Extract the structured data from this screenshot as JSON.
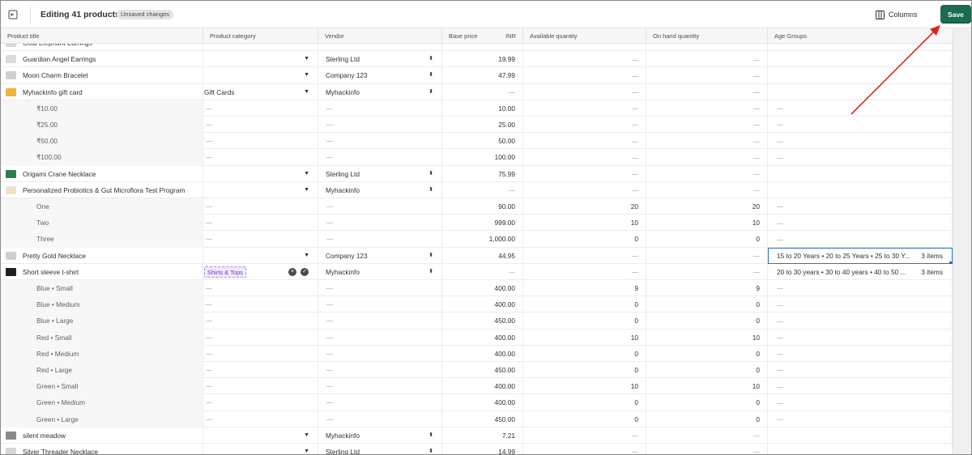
{
  "topbar": {
    "title": "Editing 41 products",
    "badge": "Unsaved changes",
    "columns_label": "Columns",
    "save_label": "Save"
  },
  "columns": {
    "title": "Product title",
    "category": "Product category",
    "vendor": "Vendor",
    "price": "Base price",
    "currency": "INR",
    "available": "Available quantity",
    "onhand": "On hand quantity",
    "age": "Age Groups"
  },
  "rows": [
    {
      "kind": "product",
      "title": "Gold Elephant Earrings",
      "thumb": "#d9d9d9",
      "category": "",
      "vendor": "",
      "price": "",
      "available": "",
      "onhand": "",
      "age": ""
    },
    {
      "kind": "product",
      "title": "Guardian Angel Earrings",
      "thumb": "#dcdcdc",
      "category": "",
      "vendor": "Sterling Ltd",
      "price": "19.99",
      "available": "dash",
      "onhand": "dash",
      "age": ""
    },
    {
      "kind": "product",
      "title": "Moon Charm Bracelet",
      "thumb": "#cfcfcf",
      "category": "",
      "vendor": "Company 123",
      "price": "47.99",
      "available": "dash",
      "onhand": "dash",
      "age": ""
    },
    {
      "kind": "product",
      "title": "Myhackinfo gift card",
      "thumb": "#f1b43a",
      "category": "Gift Cards",
      "vendor": "Myhackinfo",
      "price": "dash",
      "available": "dash",
      "onhand": "dash",
      "age": ""
    },
    {
      "kind": "variant",
      "title": "₹10.00",
      "category": "dash",
      "vendor": "dash",
      "price": "10.00",
      "available": "dash",
      "onhand": "dash",
      "age": "dash"
    },
    {
      "kind": "variant",
      "title": "₹25.00",
      "category": "dash",
      "vendor": "dash",
      "price": "25.00",
      "available": "dash",
      "onhand": "dash",
      "age": "dash"
    },
    {
      "kind": "variant",
      "title": "₹50.00",
      "category": "dash",
      "vendor": "dash",
      "price": "50.00",
      "available": "dash",
      "onhand": "dash",
      "age": "dash"
    },
    {
      "kind": "variant",
      "title": "₹100.00",
      "category": "dash",
      "vendor": "dash",
      "price": "100.00",
      "available": "dash",
      "onhand": "dash",
      "age": "dash"
    },
    {
      "kind": "product",
      "title": "Origami Crane Necklace",
      "thumb": "#2e7d4a",
      "category": "",
      "vendor": "Sterling Ltd",
      "price": "75.99",
      "available": "dash",
      "onhand": "dash",
      "age": ""
    },
    {
      "kind": "product",
      "title": "Personalized Probiotics & Gut Microflora Test Program",
      "thumb": "#efe3c8",
      "category": "",
      "vendor": "Myhackinfo",
      "price": "dash",
      "available": "dash",
      "onhand": "dash",
      "age": ""
    },
    {
      "kind": "variant",
      "title": "One",
      "category": "dash",
      "vendor": "dash",
      "price": "90.00",
      "available": "20",
      "onhand": "20",
      "age": "dash"
    },
    {
      "kind": "variant",
      "title": "Two",
      "category": "dash",
      "vendor": "dash",
      "price": "999.00",
      "available": "10",
      "onhand": "10",
      "age": "dash"
    },
    {
      "kind": "variant",
      "title": "Three",
      "category": "dash",
      "vendor": "dash",
      "price": "1,000.00",
      "available": "0",
      "onhand": "0",
      "age": "dash"
    },
    {
      "kind": "product",
      "title": "Pretty Gold Necklace",
      "thumb": "#d0d0d0",
      "category": "",
      "vendor": "Company 123",
      "price": "44.95",
      "available": "dash",
      "onhand": "dash",
      "age": "15 to 20 Years • 20 to 25 Years • 25 to 30 Y...",
      "age_count": "3 items",
      "selected": true
    },
    {
      "kind": "product",
      "title": "Short sleeve t-shirt",
      "thumb": "#1f1f1f",
      "category": "Shirts & Tops",
      "category_tag": true,
      "vendor": "Myhackinfo",
      "price": "dash",
      "available": "dash",
      "onhand": "dash",
      "age": "20 to 30 years • 30 to 40 years • 40 to 50 ...",
      "age_count": "3 items"
    },
    {
      "kind": "variant",
      "title": "Blue • Small",
      "category": "dash",
      "vendor": "dash",
      "price": "400.00",
      "available": "9",
      "onhand": "9",
      "age": "dash"
    },
    {
      "kind": "variant",
      "title": "Blue • Medium",
      "category": "dash",
      "vendor": "dash",
      "price": "400.00",
      "available": "0",
      "onhand": "0",
      "age": "dash"
    },
    {
      "kind": "variant",
      "title": "Blue • Large",
      "category": "dash",
      "vendor": "dash",
      "price": "450.00",
      "available": "0",
      "onhand": "0",
      "age": "dash"
    },
    {
      "kind": "variant",
      "title": "Red • Small",
      "category": "dash",
      "vendor": "dash",
      "price": "400.00",
      "available": "10",
      "onhand": "10",
      "age": "dash"
    },
    {
      "kind": "variant",
      "title": "Red • Medium",
      "category": "dash",
      "vendor": "dash",
      "price": "400.00",
      "available": "0",
      "onhand": "0",
      "age": "dash"
    },
    {
      "kind": "variant",
      "title": "Red • Large",
      "category": "dash",
      "vendor": "dash",
      "price": "450.00",
      "available": "0",
      "onhand": "0",
      "age": "dash"
    },
    {
      "kind": "variant",
      "title": "Green • Small",
      "category": "dash",
      "vendor": "dash",
      "price": "400.00",
      "available": "10",
      "onhand": "10",
      "age": "dash"
    },
    {
      "kind": "variant",
      "title": "Green • Medium",
      "category": "dash",
      "vendor": "dash",
      "price": "400.00",
      "available": "0",
      "onhand": "0",
      "age": "dash"
    },
    {
      "kind": "variant",
      "title": "Green • Large",
      "category": "dash",
      "vendor": "dash",
      "price": "450.00",
      "available": "0",
      "onhand": "0",
      "age": "dash"
    },
    {
      "kind": "product",
      "title": "silent meadow",
      "thumb": "#8a8a8a",
      "category": "",
      "vendor": "Myhackinfo",
      "price": "7.21",
      "available": "dash",
      "onhand": "dash",
      "age": ""
    },
    {
      "kind": "product",
      "title": "Silver Threader Necklace",
      "thumb": "#d6d6d6",
      "category": "",
      "vendor": "Sterling Ltd",
      "price": "14.99",
      "available": "dash",
      "onhand": "dash",
      "age": ""
    }
  ],
  "colors": {
    "save_bg": "#1a6b54",
    "annotation_arrow": "#e02020",
    "selection": "#2c6ecb"
  }
}
